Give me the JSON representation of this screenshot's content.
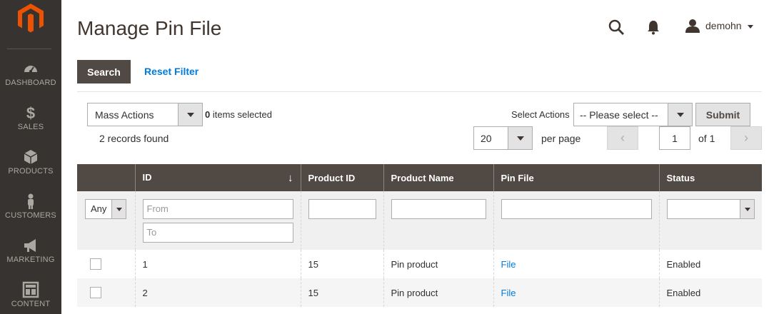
{
  "sidebar": {
    "items": [
      {
        "label": "DASHBOARD",
        "icon": "dashboard-icon"
      },
      {
        "label": "SALES",
        "icon": "dollar-icon"
      },
      {
        "label": "PRODUCTS",
        "icon": "cube-icon"
      },
      {
        "label": "CUSTOMERS",
        "icon": "person-icon"
      },
      {
        "label": "MARKETING",
        "icon": "megaphone-icon"
      },
      {
        "label": "CONTENT",
        "icon": "layout-icon"
      }
    ]
  },
  "header": {
    "title": "Manage Pin File",
    "username": "demohn"
  },
  "actions": {
    "search": "Search",
    "reset": "Reset Filter",
    "mass_actions": "Mass Actions",
    "items_selected_count": "0",
    "items_selected_text": "items selected",
    "records_found": "2 records found",
    "select_actions_label": "Select Actions",
    "select_actions_value": "-- Please select --",
    "submit": "Submit",
    "per_page_value": "20",
    "per_page_label": "per page",
    "prev": "‹",
    "page": "1",
    "of_pages": "of 1",
    "next": "›"
  },
  "grid": {
    "columns": [
      "",
      "ID",
      "Product ID",
      "Product Name",
      "Pin File",
      "Status"
    ],
    "sort_indicator": "↓",
    "filters": {
      "any": "Any",
      "from_placeholder": "From",
      "to_placeholder": "To"
    },
    "rows": [
      {
        "id": "1",
        "product_id": "15",
        "product_name": "Pin product",
        "pin_file": "File",
        "status": "Enabled"
      },
      {
        "id": "2",
        "product_id": "15",
        "product_name": "Pin product",
        "pin_file": "File",
        "status": "Enabled"
      }
    ]
  },
  "colors": {
    "sidebar_bg": "#373330",
    "accent": "#eb5202",
    "header_bg": "#514943",
    "link": "#007bdb"
  }
}
